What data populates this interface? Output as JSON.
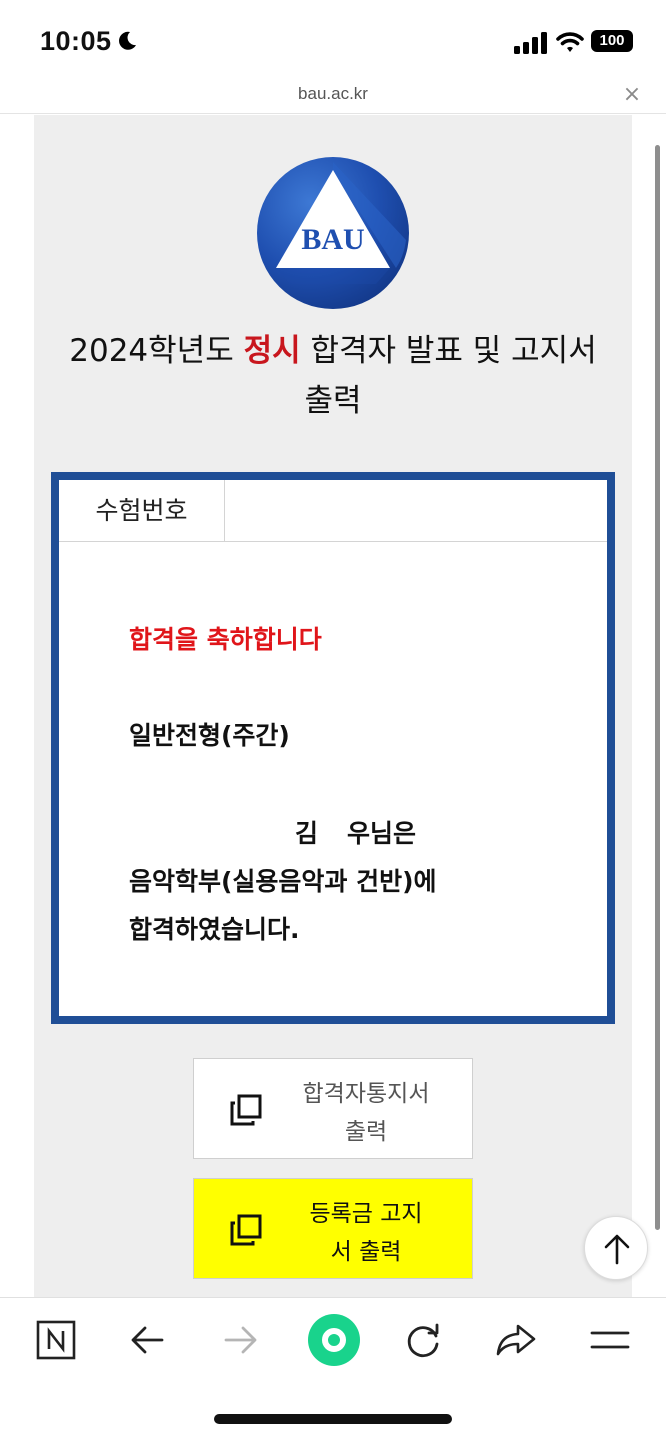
{
  "status_bar": {
    "time": "10:05",
    "battery": "100",
    "icons": [
      "moon-icon",
      "signal-icon",
      "wifi-icon",
      "battery-icon"
    ]
  },
  "browser": {
    "url": "bau.ac.kr",
    "close_symbol": "×"
  },
  "logo": {
    "text": "BAU"
  },
  "title": {
    "part1": "2024학년도 ",
    "highlight": "정시",
    "part2": " 합격자 발표 및 고지서",
    "line2": "출력"
  },
  "result": {
    "exam_number_label": "수험번호",
    "exam_number_value": "",
    "congrats": "합격을 축하합니다",
    "admission_type": "일반전형(주간)",
    "name_first": "김",
    "name_rest": "우님은",
    "department": "음악학부(실용음악과 건반)에",
    "passed": "합격하였습니다."
  },
  "buttons": {
    "notice_line1": "합격자통지서",
    "notice_line2": "출력",
    "tuition_line1": "등록금 고지",
    "tuition_line2": "서 출력"
  },
  "bottom_nav": [
    "naver-icon",
    "back-arrow-icon",
    "forward-arrow-icon",
    "green-dot-icon",
    "refresh-icon",
    "share-icon",
    "menu-icon"
  ],
  "colors": {
    "accent_red": "#c8161d",
    "box_border_blue": "#1f4e96",
    "tuition_button_yellow": "#ffff00",
    "nav_green": "#19d38c"
  }
}
